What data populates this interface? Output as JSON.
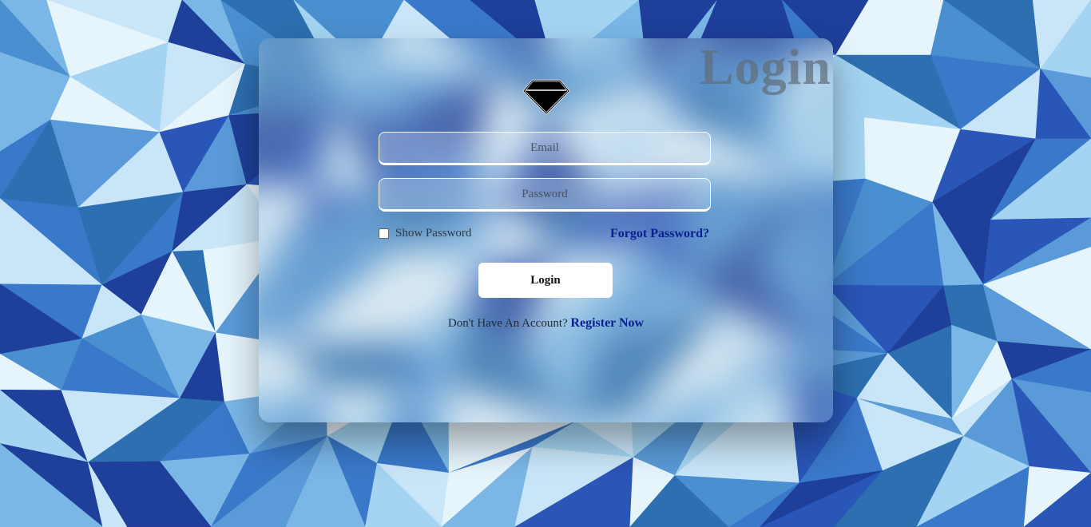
{
  "background": {
    "base_color": "#3f7fc4",
    "palette": [
      "#1e3f9a",
      "#2a56b8",
      "#3a78c9",
      "#5a9ad8",
      "#7ab6e6",
      "#a4d4f2",
      "#c9e6f8",
      "#e6f4fc",
      "#2d6fb0",
      "#4a8fd0"
    ]
  },
  "card": {
    "title": "Login",
    "logo_icon": "diamond-icon",
    "email_placeholder": "Email",
    "password_placeholder": "Password",
    "show_password_label": "Show Password",
    "show_password_checked": false,
    "forgot_password_label": "Forgot Password?",
    "login_button_label": "Login",
    "register_prompt": "Don't Have An Account?",
    "register_link_label": "Register Now",
    "link_color": "#0a1f8f"
  }
}
